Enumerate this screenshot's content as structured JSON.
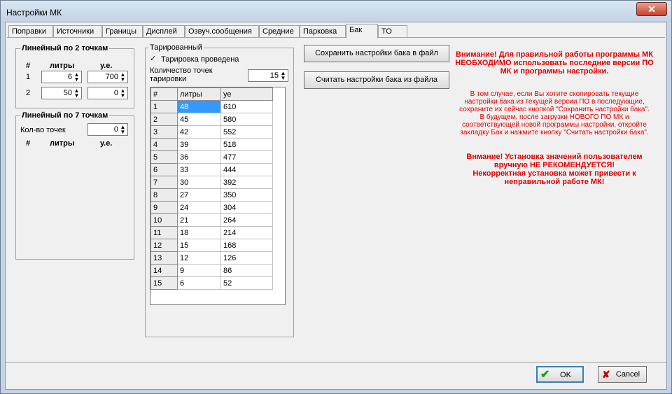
{
  "window": {
    "title": "Настройки МК"
  },
  "tabs": [
    "Поправки",
    "Источники",
    "Границы",
    "Дисплей",
    "Озвуч.сообщения",
    "Средние",
    "Парковка",
    "Бак",
    "ТО"
  ],
  "linear2": {
    "title": "Линейный по 2 точкам",
    "col_num": "#",
    "col_liters": "литры",
    "col_units": "у.е.",
    "rows": [
      {
        "num": "1",
        "liters": "6",
        "units": "700"
      },
      {
        "num": "2",
        "liters": "50",
        "units": "0"
      }
    ]
  },
  "linear7": {
    "title": "Линейный по 7 точкам",
    "count_label": "Кол-во точек",
    "count_value": "0",
    "col_num": "#",
    "col_liters": "литры",
    "col_units": "у.е."
  },
  "calibrated": {
    "title": "Тарированный",
    "checkbox_label": "Тарировка проведена",
    "points_label_1": "Количество точек",
    "points_label_2": "тарировки",
    "points_value": "15",
    "headers": [
      "#",
      "литры",
      "уе"
    ],
    "rows": [
      [
        "1",
        "48",
        "610"
      ],
      [
        "2",
        "45",
        "580"
      ],
      [
        "3",
        "42",
        "552"
      ],
      [
        "4",
        "39",
        "518"
      ],
      [
        "5",
        "36",
        "477"
      ],
      [
        "6",
        "33",
        "444"
      ],
      [
        "7",
        "30",
        "392"
      ],
      [
        "8",
        "27",
        "350"
      ],
      [
        "9",
        "24",
        "304"
      ],
      [
        "10",
        "21",
        "264"
      ],
      [
        "11",
        "18",
        "214"
      ],
      [
        "12",
        "15",
        "168"
      ],
      [
        "13",
        "12",
        "126"
      ],
      [
        "14",
        "9",
        "86"
      ],
      [
        "15",
        "6",
        "52"
      ]
    ]
  },
  "buttons": {
    "save": "Сохранить настройки бака в файл",
    "load": "Считать настройки бака из файла",
    "ok": "OK",
    "cancel": "Cancel"
  },
  "warnings": {
    "w1": [
      "Внимание! Для правильной работы программы МК",
      "НЕОБХОДИМО использовать последние версии ПО",
      "МК и программы настройки."
    ],
    "w2": [
      "В том случае, если Вы хотите скопировать текущие",
      "настройки бака из текущей версии ПО в последующие,",
      "сохраните их сейчас кнопкой \"Сохранить настройки бака\".",
      "В будущем, после загрузки НОВОГО ПО МК и",
      "соответствующей новой программы настройки, откройте",
      "закладку Бак и нажмите кнопку \"Считать настройки бака\"."
    ],
    "w3": [
      "Внмание! Установка значений пользователем",
      "вручную НЕ РЕКОМЕНДУЕТСЯ!",
      "Некорректная установка может привести к",
      "неправильной работе МК!"
    ]
  },
  "colors": {
    "warning": "#e00000",
    "selection": "#3399ff"
  }
}
